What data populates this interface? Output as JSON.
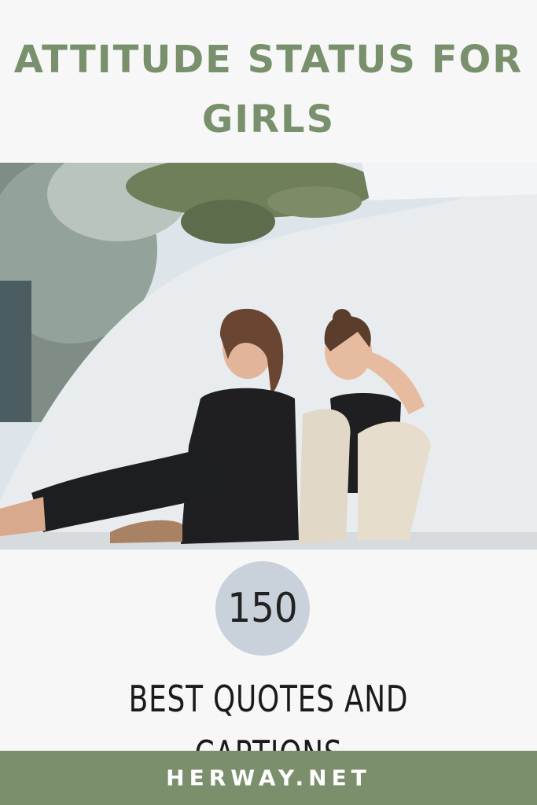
{
  "header": {
    "title_line1": "ATTITUDE STATUS FOR",
    "title_line2": "GIRLS"
  },
  "badge": {
    "number": "150"
  },
  "subtitle": "BEST QUOTES AND CAPTIONS",
  "footer": {
    "site": "HERWAY.NET"
  },
  "colors": {
    "accent_green": "#78906b",
    "footer_green": "#7c8f6c",
    "badge_grey": "#c9d1da",
    "background": "#f7f7f7"
  }
}
